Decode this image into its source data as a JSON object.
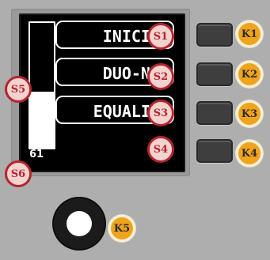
{
  "display": {
    "menu": [
      {
        "label": "INICIO"
      },
      {
        "label": "DUO-NE"
      },
      {
        "label": "EQUALIZ"
      }
    ],
    "meter": {
      "value": "61",
      "level": 0.45
    }
  },
  "callouts": {
    "s1": "S1",
    "s2": "S2",
    "s3": "S3",
    "s4": "S4",
    "s5": "S5",
    "s6": "S6",
    "k1": "K1",
    "k2": "K2",
    "k3": "K3",
    "k4": "K4",
    "k5": "K5"
  },
  "colors": {
    "panel": "#aeaeae",
    "screen": "#000000",
    "callout_red": "#b3262c",
    "callout_orange": "#f0a41c"
  }
}
